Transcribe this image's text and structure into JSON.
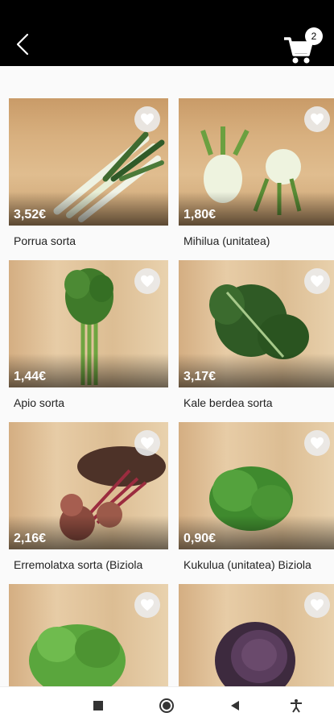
{
  "header": {
    "back_icon": "chevron-left-icon",
    "cart_icon": "shopping-cart-icon",
    "cart_count": "2"
  },
  "products": [
    {
      "name": "Porrua sorta",
      "price": "3,52€",
      "image": "leeks"
    },
    {
      "name": "Mihilua (unitatea)",
      "price": "1,80€",
      "image": "fennel"
    },
    {
      "name": "Apio sorta",
      "price": "1,44€",
      "image": "celery"
    },
    {
      "name": "Kale berdea sorta",
      "price": "3,17€",
      "image": "kale"
    },
    {
      "name": "Erremolatxa sorta (Biziola",
      "price": "2,16€",
      "image": "beetroot"
    },
    {
      "name": "Kukulua (unitatea) Biziola",
      "price": "0,90€",
      "image": "lettuce"
    },
    {
      "name": "",
      "price": "",
      "image": "green-lettuce"
    },
    {
      "name": "",
      "price": "",
      "image": "red-cabbage"
    }
  ],
  "navbar": {
    "icons": [
      "stop-square-icon",
      "home-circle-icon",
      "back-triangle-icon",
      "accessibility-icon"
    ]
  }
}
